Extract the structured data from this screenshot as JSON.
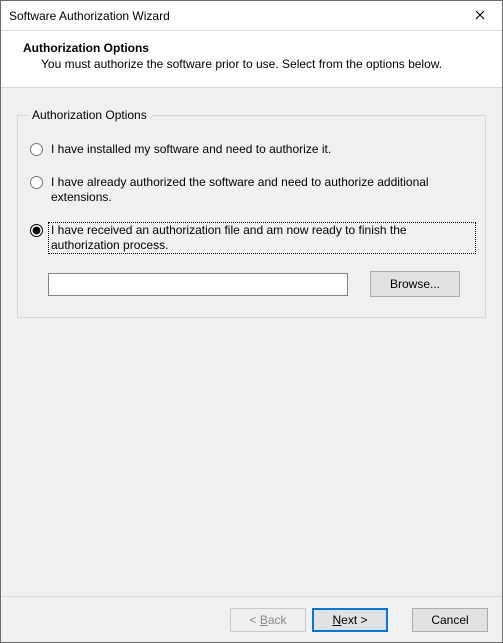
{
  "window": {
    "title": "Software Authorization Wizard"
  },
  "header": {
    "title": "Authorization Options",
    "subtitle": "You must authorize the software prior to use. Select from the options below."
  },
  "group": {
    "legend": "Authorization Options",
    "options": [
      {
        "label": "I have installed my software and need to authorize it.",
        "selected": false
      },
      {
        "label": "I have already authorized the software and need to authorize additional extensions.",
        "selected": false
      },
      {
        "label": "I have received an authorization file and am now ready to finish the authorization process.",
        "selected": true
      }
    ],
    "file_path": "",
    "browse_label": "Browse..."
  },
  "footer": {
    "back_prefix": "< ",
    "back_accel": "B",
    "back_rest": "ack",
    "next_accel": "N",
    "next_rest": "ext >",
    "cancel_label": "Cancel"
  }
}
